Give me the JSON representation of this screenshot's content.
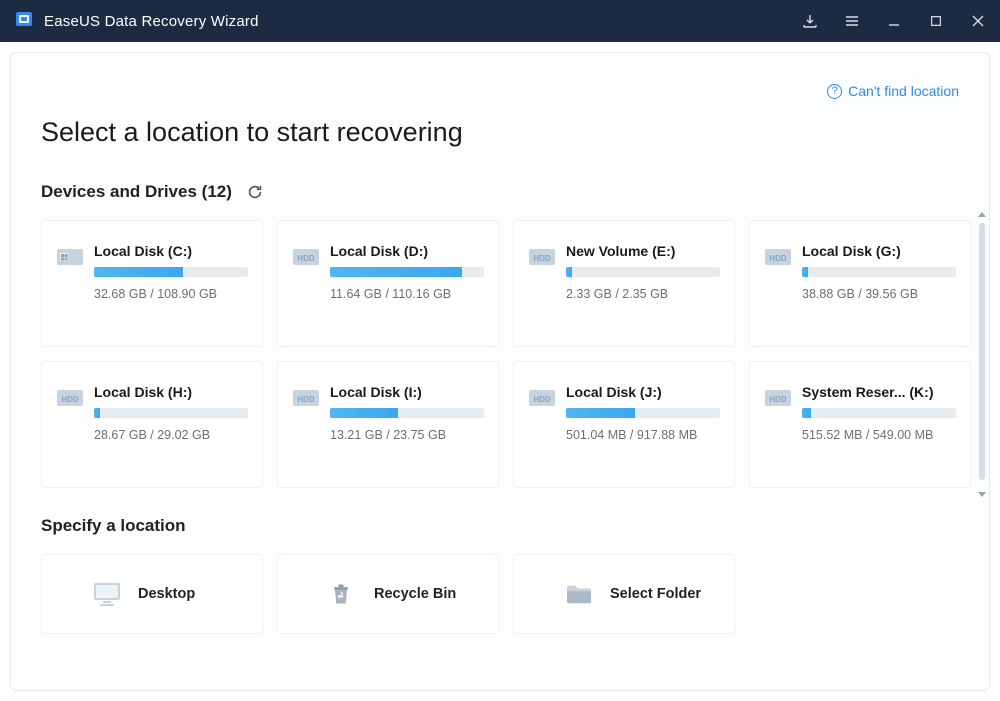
{
  "app_title": "EaseUS Data Recovery Wizard",
  "help_link": "Can't find location",
  "page_title": "Select a location to start recovering",
  "section_drives": {
    "label": "Devices and Drives",
    "count": "(12)"
  },
  "section_specify": "Specify a location",
  "drives": [
    {
      "name": "Local Disk (C:)",
      "stats": "32.68 GB / 108.90 GB",
      "pct": 58,
      "type": "os"
    },
    {
      "name": "Local Disk (D:)",
      "stats": "11.64 GB / 110.16 GB",
      "pct": 86,
      "type": "hdd"
    },
    {
      "name": "New Volume (E:)",
      "stats": "2.33 GB / 2.35 GB",
      "pct": 4,
      "type": "hdd"
    },
    {
      "name": "Local Disk (G:)",
      "stats": "38.88 GB / 39.56 GB",
      "pct": 4,
      "type": "hdd"
    },
    {
      "name": "Local Disk (H:)",
      "stats": "28.67 GB / 29.02 GB",
      "pct": 4,
      "type": "hdd"
    },
    {
      "name": "Local Disk (I:)",
      "stats": "13.21 GB / 23.75 GB",
      "pct": 44,
      "type": "hdd"
    },
    {
      "name": "Local Disk (J:)",
      "stats": "501.04 MB / 917.88 MB",
      "pct": 45,
      "type": "hdd"
    },
    {
      "name": "System Reser... (K:)",
      "stats": "515.52 MB / 549.00 MB",
      "pct": 6,
      "type": "hdd"
    }
  ],
  "locations": [
    {
      "name": "Desktop",
      "icon": "desktop"
    },
    {
      "name": "Recycle Bin",
      "icon": "recycle"
    },
    {
      "name": "Select Folder",
      "icon": "folder"
    }
  ]
}
